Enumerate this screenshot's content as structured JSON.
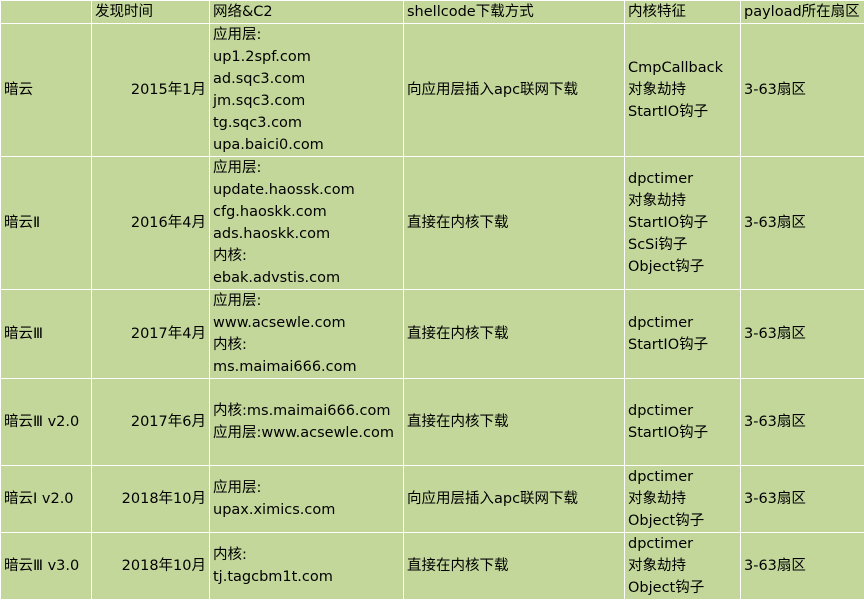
{
  "headers": [
    "",
    "发现时间",
    "网络&C2",
    "shellcode下载方式",
    "内核特征",
    "payload所在扇区"
  ],
  "rows": [
    {
      "name": "暗云",
      "date": "2015年1月",
      "c2": [
        "应用层:",
        "up1.2spf.com",
        "ad.sqc3.com",
        "jm.sqc3.com",
        "tg.sqc3.com",
        "upa.baici0.com"
      ],
      "download": "向应用层插入apc联网下载",
      "kernel": [
        "CmpCallback",
        "对象劫持",
        "StartIO钩子"
      ],
      "sector": "3-63扇区"
    },
    {
      "name": "暗云Ⅱ",
      "date": "2016年4月",
      "c2": [
        "应用层:",
        "update.haossk.com",
        "cfg.haoskk.com",
        "ads.haoskk.com",
        "内核:",
        "ebak.advstis.com"
      ],
      "download": "直接在内核下载",
      "kernel": [
        "dpctimer",
        "对象劫持",
        "StartIO钩子",
        "ScSi钩子",
        "Object钩子"
      ],
      "sector": "3-63扇区"
    },
    {
      "name": "暗云Ⅲ",
      "date": "2017年4月",
      "c2": [
        "应用层:",
        "www.acsewle.com",
        "内核:",
        "ms.maimai666.com"
      ],
      "download": "直接在内核下载",
      "kernel": [
        "dpctimer",
        "StartIO钩子"
      ],
      "sector": "3-63扇区"
    },
    {
      "name": "暗云Ⅲ v2.0",
      "date": "2017年6月",
      "c2": [
        "内核:ms.maimai666.com",
        "应用层:www.acsewle.com"
      ],
      "download": "直接在内核下载",
      "kernel": [
        "dpctimer",
        "StartIO钩子"
      ],
      "sector": "3-63扇区"
    },
    {
      "name": "暗云I v2.0",
      "date": "2018年10月",
      "c2": [
        "应用层:",
        "upax.ximics.com"
      ],
      "download": "向应用层插入apc联网下载",
      "kernel": [
        "dpctimer",
        "对象劫持",
        "Object钩子"
      ],
      "sector": "3-63扇区"
    },
    {
      "name": "暗云Ⅲ v3.0",
      "date": "2018年10月",
      "c2": [
        "内核:",
        "tj.tagcbm1t.com"
      ],
      "download": "直接在内核下载",
      "kernel": [
        "dpctimer",
        "对象劫持",
        "Object钩子"
      ],
      "sector": "3-63扇区"
    }
  ]
}
